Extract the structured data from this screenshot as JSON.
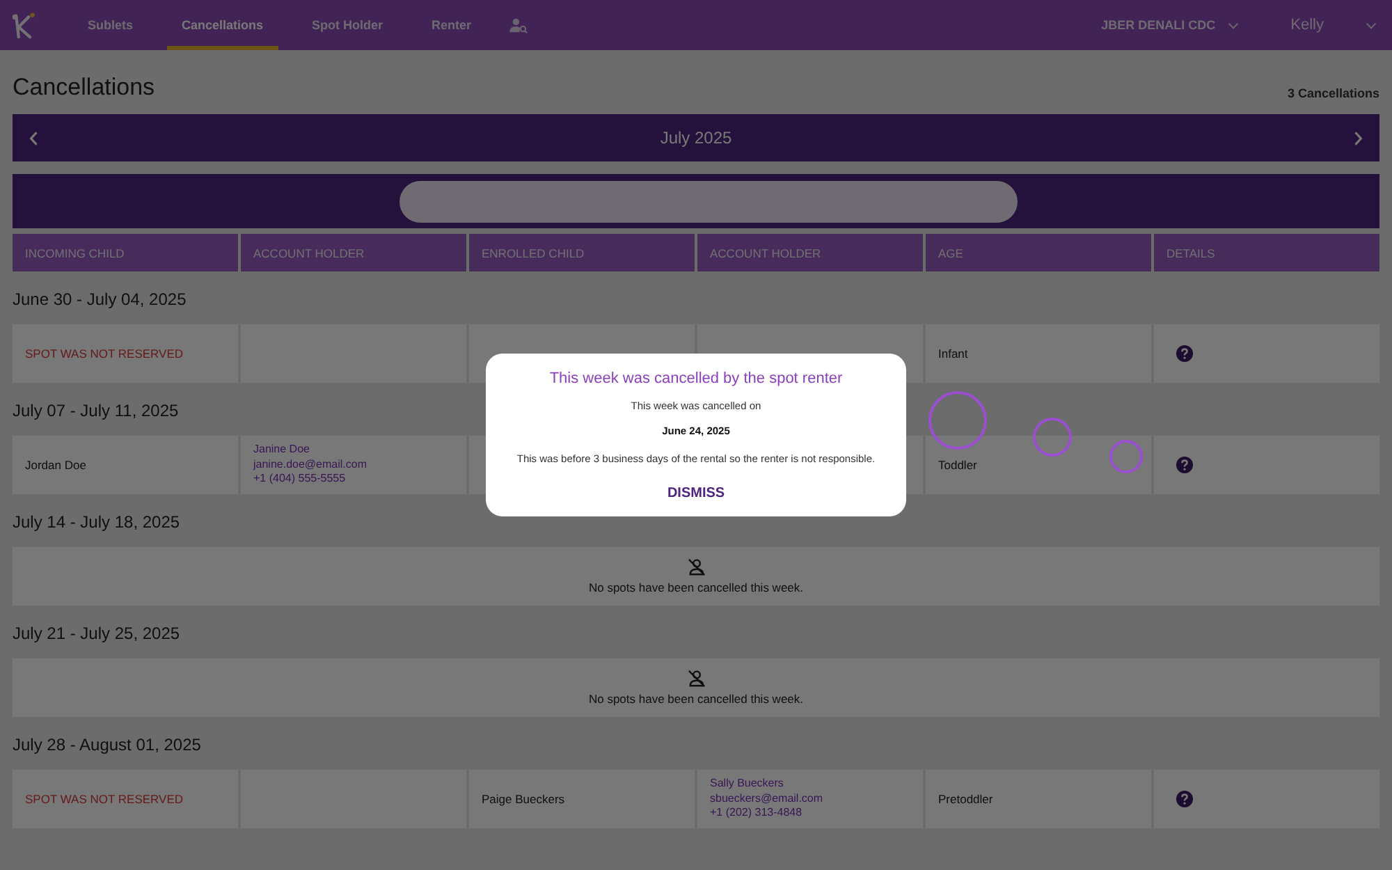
{
  "nav": {
    "tabs": [
      {
        "label": "Sublets",
        "selected": false
      },
      {
        "label": "Cancellations",
        "selected": true
      },
      {
        "label": "Spot Holder",
        "selected": false
      },
      {
        "label": "Renter",
        "selected": false
      }
    ],
    "org": "JBER DENALI CDC",
    "user": "Kelly"
  },
  "page": {
    "title": "Cancellations",
    "count": "3 Cancellations",
    "month": "July 2025"
  },
  "columns": [
    "INCOMING CHILD",
    "ACCOUNT HOLDER",
    "ENROLLED CHILD",
    "ACCOUNT HOLDER",
    "AGE",
    "DETAILS"
  ],
  "weeks": [
    {
      "range": "June 30 - July 04, 2025",
      "rows": [
        {
          "cells": [
            {
              "kind": "warning",
              "text": "SPOT WAS NOT RESERVED"
            },
            {
              "kind": "empty"
            },
            {
              "kind": "empty"
            },
            {
              "kind": "empty"
            },
            {
              "kind": "text",
              "text": "Infant"
            },
            {
              "kind": "help"
            }
          ]
        }
      ]
    },
    {
      "range": "July 07 - July 11, 2025",
      "rows": [
        {
          "cells": [
            {
              "kind": "text",
              "text": "Jordan Doe"
            },
            {
              "kind": "contact",
              "lines": [
                "Janine Doe",
                "janine.doe@email.com",
                "+1 (404) 555-5555"
              ]
            },
            {
              "kind": "empty"
            },
            {
              "kind": "empty"
            },
            {
              "kind": "text",
              "text": "Toddler"
            },
            {
              "kind": "help"
            }
          ]
        }
      ]
    },
    {
      "range": "July 14 - July 18, 2025",
      "empty_message": "No spots have been cancelled this week."
    },
    {
      "range": "July 21 - July 25, 2025",
      "empty_message": "No spots have been cancelled this week."
    },
    {
      "range": "July 28 - August 01, 2025",
      "rows": [
        {
          "cells": [
            {
              "kind": "warning",
              "text": "SPOT WAS NOT RESERVED"
            },
            {
              "kind": "empty"
            },
            {
              "kind": "text",
              "text": "Paige Bueckers"
            },
            {
              "kind": "contact",
              "lines": [
                "Sally Bueckers",
                "sbueckers@email.com",
                "+1 (202) 313-4848"
              ]
            },
            {
              "kind": "text",
              "text": "Pretoddler"
            },
            {
              "kind": "help"
            }
          ]
        }
      ]
    }
  ],
  "dialog": {
    "title": "This week was cancelled by the spot renter",
    "intro": "This week was cancelled on",
    "date": "June 24, 2025",
    "note": "This was before 3 business days of the rental so the renter is not responsible.",
    "button": "DISMISS"
  }
}
